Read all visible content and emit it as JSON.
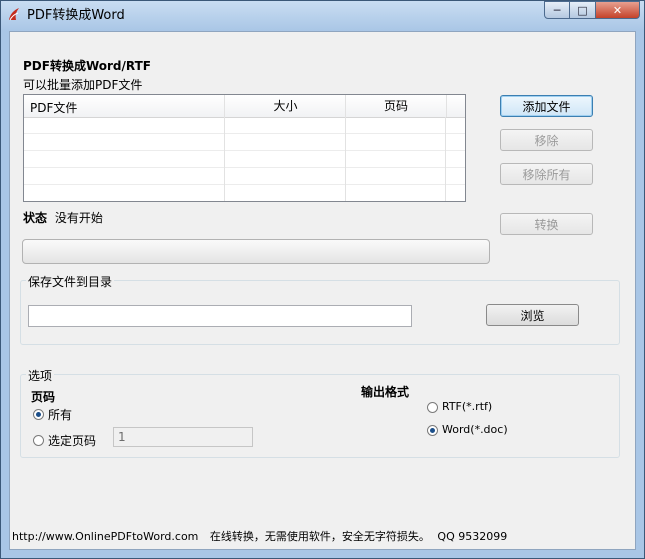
{
  "window": {
    "title": "PDF转换成Word",
    "min_icon": "minimize-icon",
    "max_icon": "maximize-icon",
    "close_icon": "close-icon"
  },
  "header": {
    "title": "PDF转换成Word/RTF",
    "subtitle": "可以批量添加PDF文件"
  },
  "file_list": {
    "columns": [
      "PDF文件",
      "大小",
      "页码"
    ],
    "rows": []
  },
  "buttons": {
    "add": "添加文件",
    "remove": "移除",
    "remove_all": "移除所有",
    "convert": "转换",
    "browse": "浏览"
  },
  "status": {
    "label": "状态",
    "value": "没有开始",
    "progress": 0
  },
  "save": {
    "group_label": "保存文件到目录",
    "path": ""
  },
  "options": {
    "group_label": "选项",
    "pages_label": "页码",
    "all_label": "所有",
    "range_label": "选定页码",
    "range_value": "1",
    "selected_pages": "所有",
    "format_label": "输出格式",
    "rtf_label": "RTF(*.rtf)",
    "doc_label": "Word(*.doc)",
    "selected_format": "Word(*.doc)"
  },
  "footer": {
    "url": "http://www.OnlinePDFtoWord.com",
    "text": "在线转换，无需使用软件，安全无字符损失。",
    "qq": "QQ 9532099"
  },
  "colors": {
    "accent": "#3c7fb1",
    "title_bg": "#a9c6e6",
    "icon_red": "#c42b1c"
  }
}
